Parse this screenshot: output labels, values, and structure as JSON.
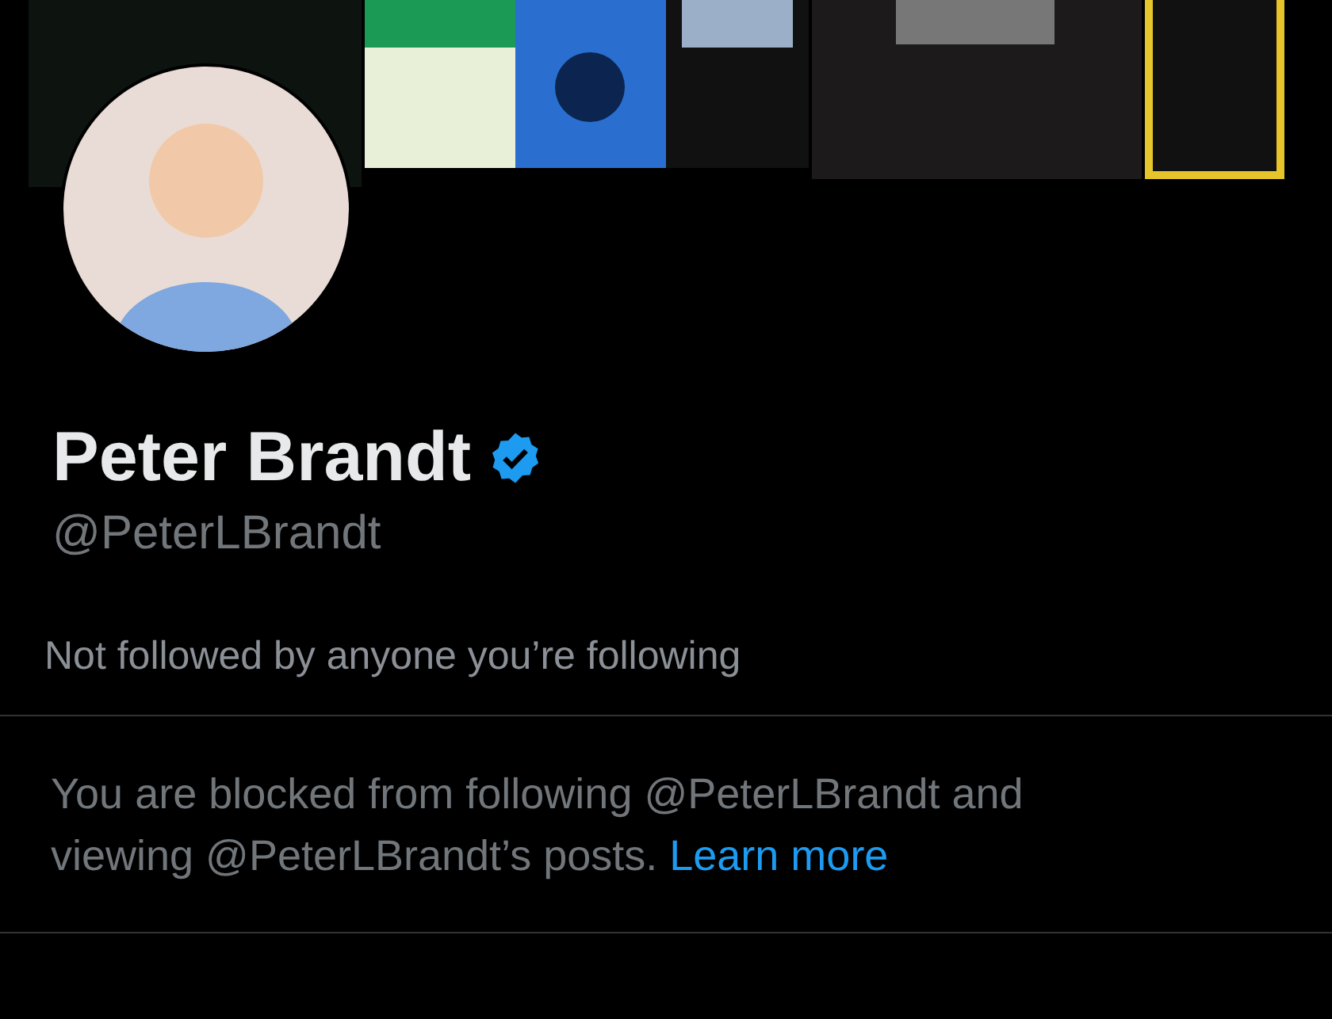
{
  "profile": {
    "name": "Peter Brandt",
    "verified": true,
    "handle": "@PeterLBrandt"
  },
  "followers_note": "Not followed by anyone you’re following",
  "blocked_notice": {
    "text": "You are blocked from following @PeterLBrandt and viewing @PeterLBrandt’s posts.",
    "link": "Learn more"
  }
}
